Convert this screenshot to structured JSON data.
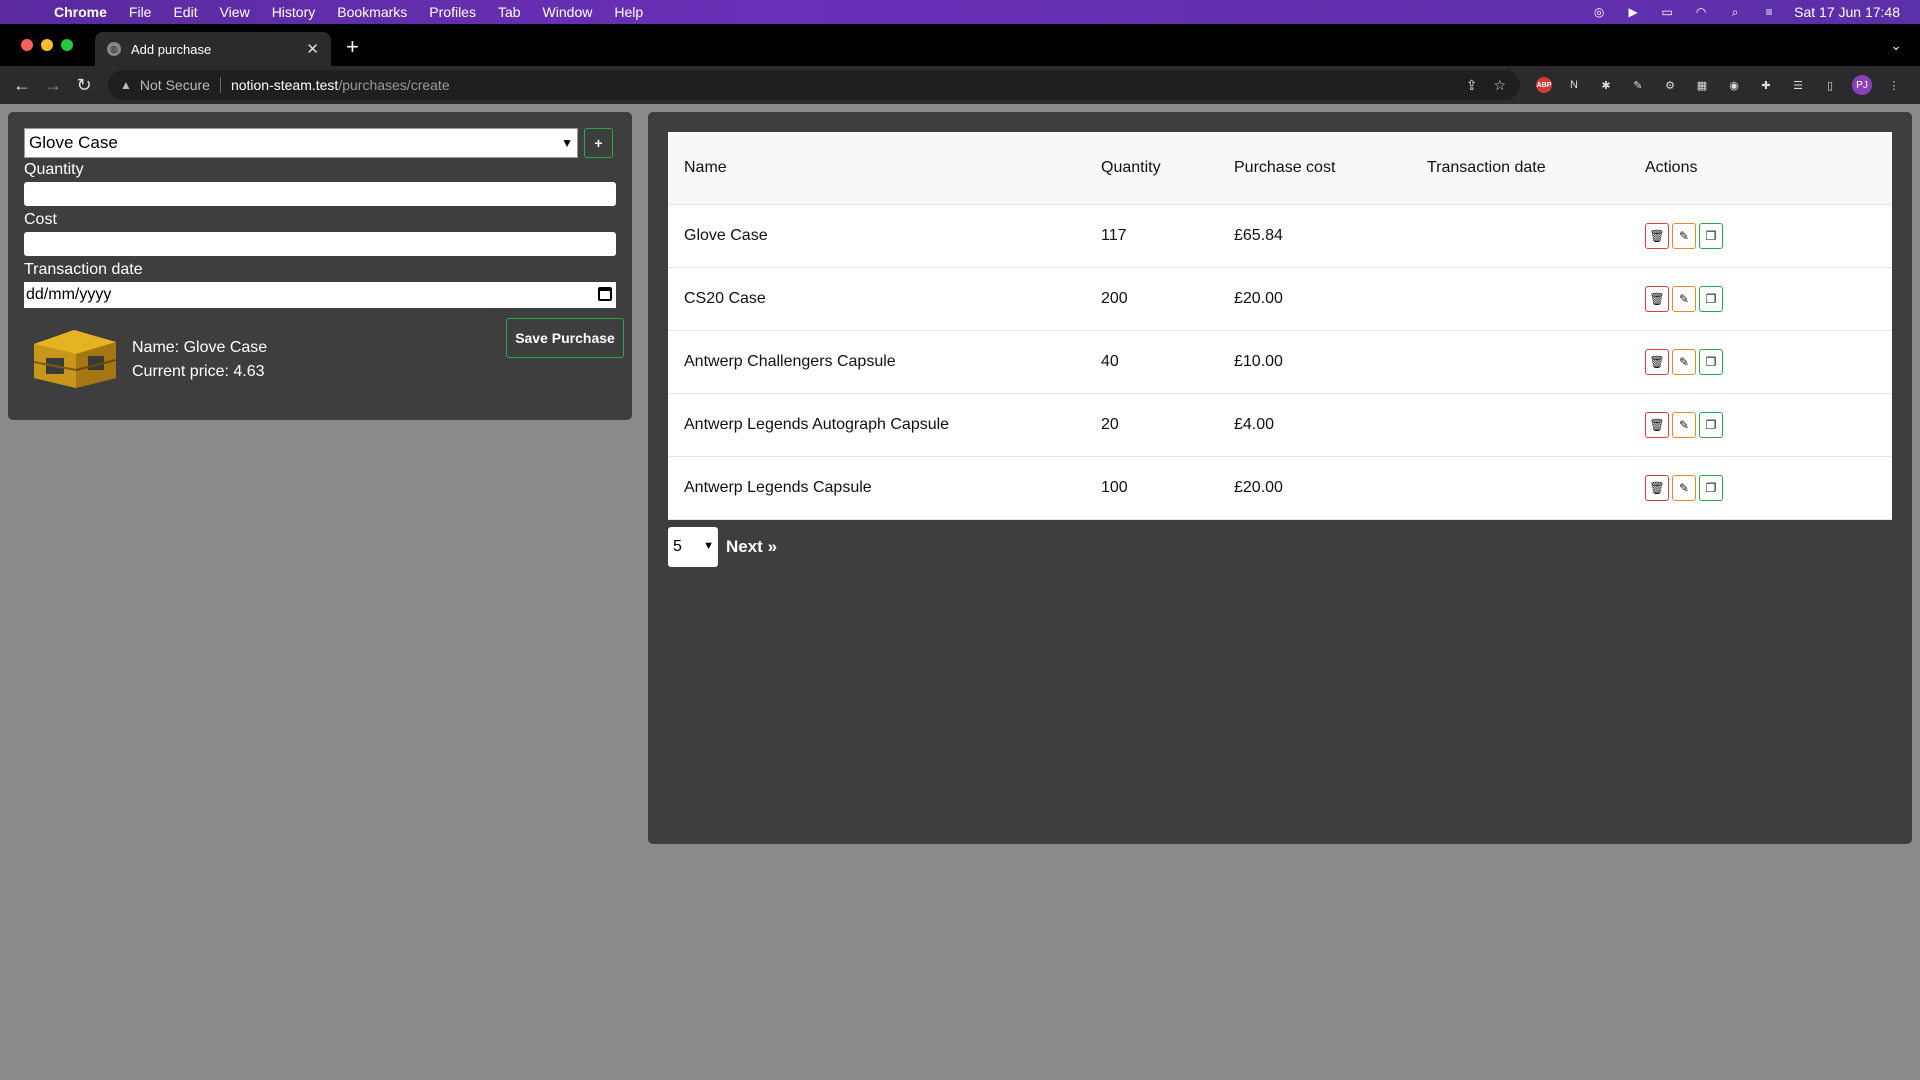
{
  "menubar": {
    "app": "Chrome",
    "items": [
      "File",
      "Edit",
      "View",
      "History",
      "Bookmarks",
      "Profiles",
      "Tab",
      "Window",
      "Help"
    ],
    "clock": "Sat 17 Jun  17:48"
  },
  "browser": {
    "tab_title": "Add purchase",
    "security_label": "Not Secure",
    "url_host": "notion-steam.test",
    "url_path": "/purchases/create",
    "profile_initials": "PJ"
  },
  "form": {
    "selected_item": "Glove Case",
    "add_label": "+",
    "quantity_label": "Quantity",
    "quantity_value": "",
    "cost_label": "Cost",
    "cost_value": "",
    "date_label": "Transaction date",
    "date_placeholder": "dd/mm/yyyy",
    "preview_name": "Name: Glove Case",
    "preview_price": "Current price: 4.63",
    "save_label": "Save Purchase"
  },
  "table": {
    "headers": [
      "Name",
      "Quantity",
      "Purchase cost",
      "Transaction date",
      "Actions"
    ],
    "rows": [
      {
        "name": "Glove Case",
        "quantity": "117",
        "cost": "£65.84",
        "date": ""
      },
      {
        "name": "CS20 Case",
        "quantity": "200",
        "cost": "£20.00",
        "date": ""
      },
      {
        "name": "Antwerp Challengers Capsule",
        "quantity": "40",
        "cost": "£10.00",
        "date": ""
      },
      {
        "name": "Antwerp Legends Autograph Capsule",
        "quantity": "20",
        "cost": "£4.00",
        "date": ""
      },
      {
        "name": "Antwerp Legends Capsule",
        "quantity": "100",
        "cost": "£20.00",
        "date": ""
      }
    ]
  },
  "pagination": {
    "per_page": "5",
    "next_label": "Next »"
  },
  "colors": {
    "delete": "#e03b3b",
    "edit": "#e58a2b",
    "duplicate": "#2ea44f"
  }
}
